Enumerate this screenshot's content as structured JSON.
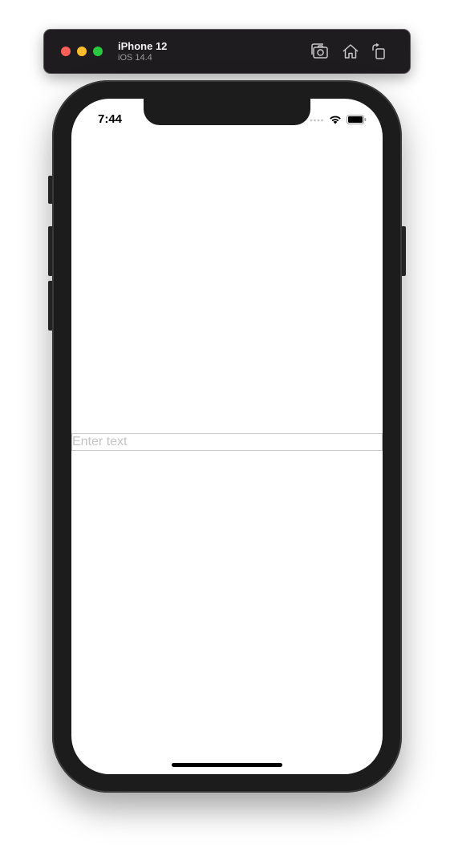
{
  "simulator": {
    "device_name": "iPhone 12",
    "os_version": "iOS 14.4",
    "traffic_lights": {
      "close": "#fe5f57",
      "minimize": "#febc2e",
      "maximize": "#28c840"
    },
    "toolbar_icons": [
      "screenshot-icon",
      "home-icon",
      "rotate-icon"
    ]
  },
  "status_bar": {
    "time": "7:44",
    "icons": [
      "cellular-signal-icon",
      "wifi-icon",
      "battery-icon"
    ]
  },
  "main": {
    "text_field": {
      "value": "",
      "placeholder": "Enter text"
    }
  },
  "colors": {
    "device_frame": "#1c1c1c",
    "screen_background": "#ffffff",
    "field_border": "#c9c9c9",
    "placeholder": "#c4c4c6"
  }
}
